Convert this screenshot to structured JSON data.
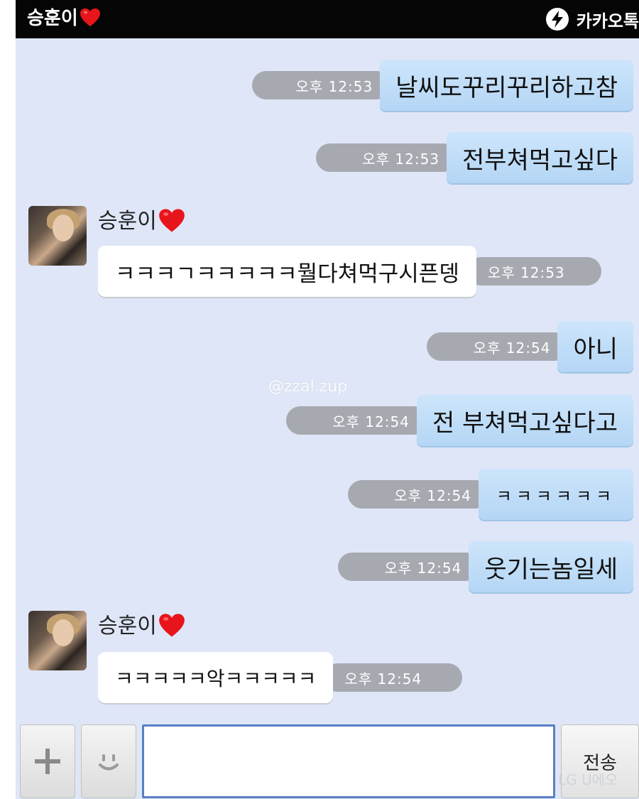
{
  "title_bar": {
    "room_name": "승훈이",
    "brand_label": "카카오톡",
    "brand_icon": "kakao-lightning-icon"
  },
  "messages": [
    {
      "dir": "out",
      "text": "날씨도꾸리꾸리하고참",
      "time": "오후 12:53"
    },
    {
      "dir": "out",
      "text": "전부쳐먹고싶다",
      "time": "오후 12:53"
    },
    {
      "dir": "in",
      "sender": "승훈이",
      "text": "ㅋㅋㅋㄱㅋㅋㅋㅋㅋ뭘다쳐먹구시픈뎅",
      "time": "오후 12:53"
    },
    {
      "dir": "out",
      "text": "아니",
      "time": "오후 12:54"
    },
    {
      "dir": "out",
      "text": "전 부쳐먹고싶다고",
      "time": "오후 12:54"
    },
    {
      "dir": "out",
      "text": "ㅋㅋㅋㅋㅋㅋ",
      "time": "오후 12:54"
    },
    {
      "dir": "out",
      "text": "웃기는놈일세",
      "time": "오후 12:54"
    },
    {
      "dir": "in",
      "sender": "승훈이",
      "text": "ㅋㅋㅋㅋㅋ악ㅋㅋㅋㅋㅋ",
      "time": "오후 12:54"
    }
  ],
  "watermark": "@zzal.zup",
  "input_bar": {
    "add_icon": "plus-icon",
    "emoticon_icon": "smiley-icon",
    "message_value": "",
    "send_label": "전송"
  },
  "device_mark": "LG U에오",
  "colors": {
    "chat_background": "#dfe6f7",
    "outgoing_bubble": "#bfdcf7",
    "incoming_bubble": "#ffffff",
    "timestamp_pill": "#a7a9b1",
    "title_bar": "#050505",
    "heart": "#e8141b",
    "input_border": "#5a7fc4"
  }
}
